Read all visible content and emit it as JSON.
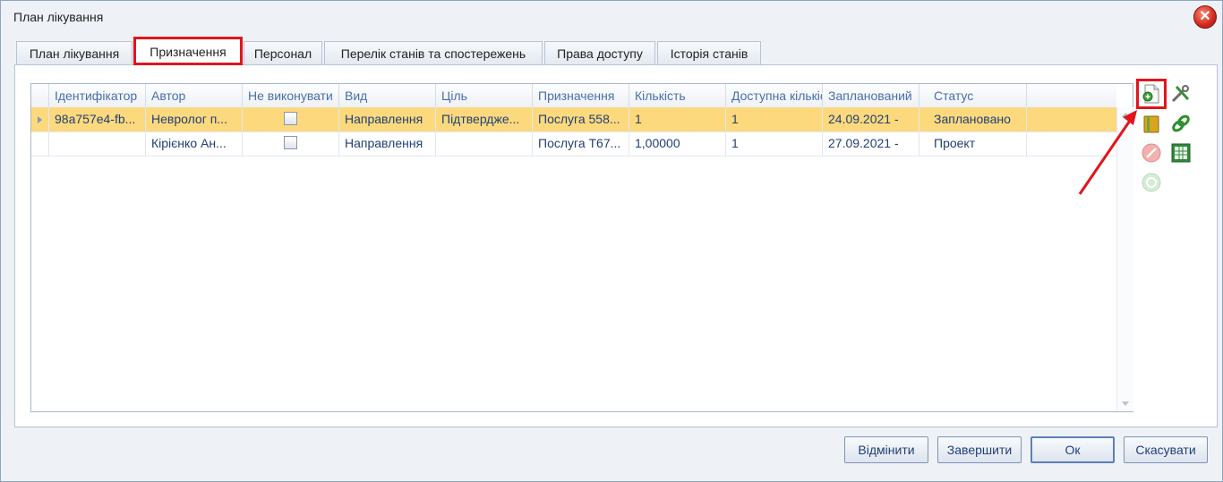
{
  "window": {
    "title": "План лікування",
    "close_symbol": "✕"
  },
  "tabs": [
    {
      "label": "План лікування"
    },
    {
      "label": "Призначення"
    },
    {
      "label": "Персонал"
    },
    {
      "label": "Перелік станів та спостережень"
    },
    {
      "label": "Права доступу"
    },
    {
      "label": "Історія станів"
    }
  ],
  "grid": {
    "columns": [
      "Ідентифікатор",
      "Автор",
      "Не виконувати",
      "Вид",
      "Ціль",
      "Призначення",
      "Кількість",
      "Доступна кількість",
      "Запланований",
      "Статус"
    ],
    "rows": [
      {
        "id": "98a757e4-fb...",
        "author": "Невролог п...",
        "not_execute": false,
        "kind": "Направлення",
        "goal": "Підтвердже...",
        "assignment": "Послуга 558...",
        "quantity": "1",
        "available": "1",
        "planned": "24.09.2021 -",
        "status": "Заплановано"
      },
      {
        "id": "",
        "author": "Кірієнко Ан...",
        "not_execute": false,
        "kind": "Направлення",
        "goal": "",
        "assignment": "Послуга T67...",
        "quantity": "1,00000",
        "available": "1",
        "planned": "27.09.2021 -",
        "status": "Проект"
      }
    ]
  },
  "toolbar_icons": [
    "add-document-icon",
    "tools-icon",
    "book-icon",
    "link-icon",
    "cancel-icon",
    "spreadsheet-icon",
    "refresh-icon"
  ],
  "footer": {
    "undo_label": "Відмінити",
    "finish_label": "Завершити",
    "ok_label": "Ок",
    "cancel_label": "Скасувати"
  },
  "colors": {
    "selected_row": "#fcd97d",
    "highlight": "#e3141b",
    "header_text": "#4a6ea8",
    "cell_text": "#1f3f77"
  }
}
